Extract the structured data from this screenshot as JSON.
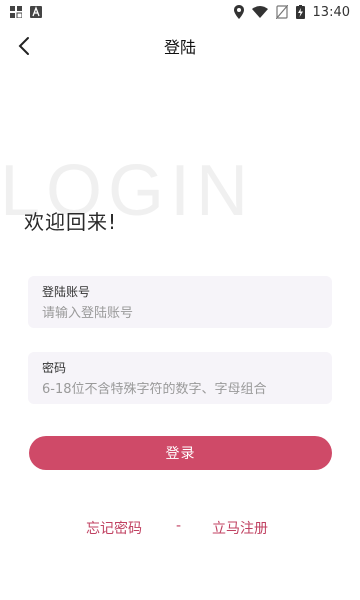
{
  "statusbar": {
    "time": "13:40",
    "left_icons": [
      "grid-app-icon",
      "text-a-icon"
    ],
    "right_icons": [
      "location-icon",
      "wifi-icon",
      "sim-off-icon",
      "battery-charging-icon"
    ]
  },
  "header": {
    "title": "登陆"
  },
  "watermark": "LOGIN",
  "welcome": "欢迎回来!",
  "fields": {
    "account": {
      "label": "登陆账号",
      "placeholder": "请输入登陆账号"
    },
    "password": {
      "label": "密码",
      "placeholder": "6-18位不含特殊字符的数字、字母组合"
    }
  },
  "buttons": {
    "login": "登录"
  },
  "links": {
    "forgot": "忘记密码",
    "separator": "-",
    "register": "立马注册"
  },
  "colors": {
    "accent": "#cf4a68",
    "link": "#c04161",
    "field_bg": "#f6f4f9"
  }
}
